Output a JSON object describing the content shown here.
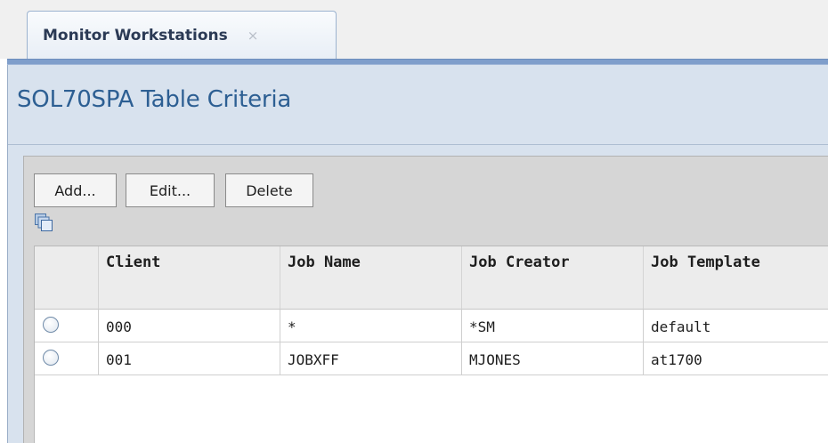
{
  "tab": {
    "label": "Monitor Workstations",
    "close_glyph": "×"
  },
  "page": {
    "title": "SOL70SPA Table Criteria"
  },
  "toolbar": {
    "add_label": "Add...",
    "edit_label": "Edit...",
    "delete_label": "Delete",
    "copy_icon": "copy-icon"
  },
  "table": {
    "columns": [
      "Client",
      "Job Name",
      "Job Creator",
      "Job Template"
    ],
    "rows": [
      {
        "client": "000",
        "job_name": "*",
        "job_creator": "*SM",
        "job_template": "default"
      },
      {
        "client": "001",
        "job_name": "JOBXFF",
        "job_creator": "MJONES",
        "job_template": "at1700"
      }
    ]
  },
  "colors": {
    "title": "#2d5f93",
    "tab_bar": "#7f9ecb",
    "panel": "#d8e2ee"
  }
}
